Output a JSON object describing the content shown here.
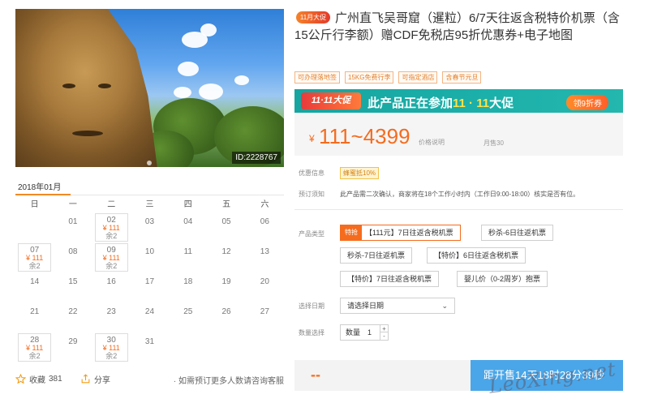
{
  "hero": {
    "image_id": "ID:2228767"
  },
  "calendar": {
    "month": "2018年01月",
    "weekdays": [
      "日",
      "一",
      "二",
      "三",
      "四",
      "五",
      "六"
    ],
    "weeks": [
      [
        {
          "d": ""
        },
        {
          "d": "01"
        },
        {
          "d": "02",
          "p": "¥ 111",
          "l": "余2"
        },
        {
          "d": "03"
        },
        {
          "d": "04"
        },
        {
          "d": "05"
        },
        {
          "d": "06"
        }
      ],
      [
        {
          "d": "07",
          "p": "¥ 111",
          "l": "余2"
        },
        {
          "d": "08"
        },
        {
          "d": "09",
          "p": "¥ 111",
          "l": "余2"
        },
        {
          "d": "10"
        },
        {
          "d": "11"
        },
        {
          "d": "12"
        },
        {
          "d": "13"
        }
      ],
      [
        {
          "d": "14"
        },
        {
          "d": "15"
        },
        {
          "d": "16"
        },
        {
          "d": "17"
        },
        {
          "d": "18"
        },
        {
          "d": "19"
        },
        {
          "d": "20"
        }
      ],
      [
        {
          "d": "21"
        },
        {
          "d": "22"
        },
        {
          "d": "23"
        },
        {
          "d": "24"
        },
        {
          "d": "25"
        },
        {
          "d": "26"
        },
        {
          "d": "27"
        }
      ],
      [
        {
          "d": "28",
          "p": "¥ 111",
          "l": "余2"
        },
        {
          "d": "29"
        },
        {
          "d": "30",
          "p": "¥ 111",
          "l": "余2"
        },
        {
          "d": "31"
        },
        {
          "d": ""
        },
        {
          "d": ""
        },
        {
          "d": ""
        }
      ]
    ]
  },
  "footer": {
    "fav_label": "收藏",
    "fav_count": "381",
    "share_label": "分享",
    "tip": "· 如需预订更多人数请咨询客服"
  },
  "product": {
    "badge": "11月大促",
    "title": "广州直飞吴哥窟（暹粒）6/7天往返含税特价机票（含15公斤行李额）赠CDF免税店95折优惠券+电子地图",
    "tags": [
      "可办理落地签",
      "15KG免费行李",
      "可指定酒店",
      "含春节元旦"
    ]
  },
  "promo": {
    "logo": "11·11大促",
    "text_prefix": "此产品正在参加",
    "text_highlight": "11 · 11",
    "text_suffix": "大促",
    "button": "领9折券"
  },
  "price": {
    "currency": "¥",
    "range": "111~4399",
    "note": "价格说明",
    "sales": "月售30"
  },
  "info": {
    "discount_label": "优惠信息",
    "discount_value": "蜂蜜抵10%",
    "booking_label": "预订须知",
    "booking_value": "此产品需二次确认，商家将在18个工作小时内（工作日9:00-18:00）核实是否有位。"
  },
  "options": {
    "label": "产品类型",
    "flag": "特抢",
    "items": [
      "【111元】7日往返含税机票",
      "秒杀-6日往返机票",
      "秒杀-7日往返机票",
      "【特价】6日往返含税机票",
      "【特价】7日往返含税机票",
      "婴儿价（0-2周岁）抱票"
    ]
  },
  "date": {
    "label": "选择日期",
    "placeholder": "请选择日期"
  },
  "quantity": {
    "label": "数量选择",
    "field_label": "数量",
    "value": "1"
  },
  "buy": {
    "price_dash": "--",
    "button": "距开售14天18时28分39秒"
  },
  "watermark": "LeoXing.net"
}
